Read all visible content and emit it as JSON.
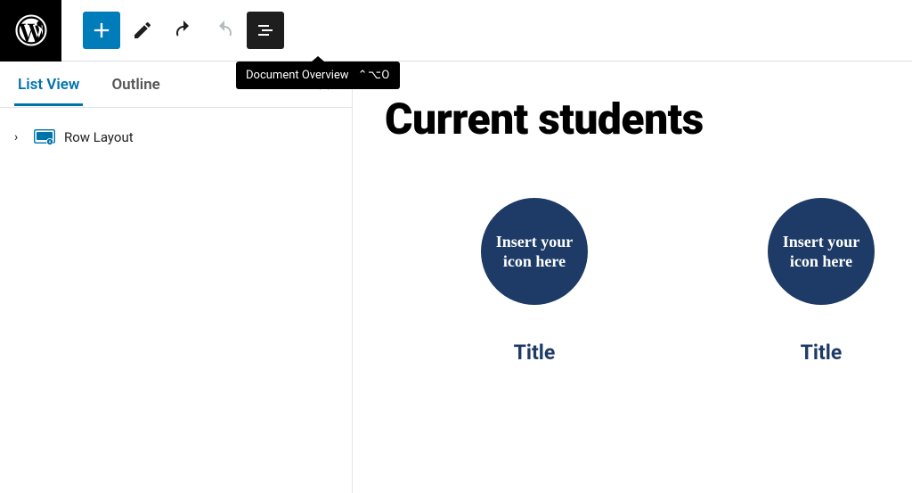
{
  "colors": {
    "wp_blue": "#007cba",
    "wp_dark": "#1e1e1e",
    "navy": "#1d3b66",
    "tab_active": "#0073aa"
  },
  "toolbar": {
    "tooltip_text": "Document Overview",
    "tooltip_shortcut": "⌃⌥O"
  },
  "sidebar": {
    "tabs": {
      "list_view": "List View",
      "outline": "Outline"
    },
    "tree": {
      "row_layout": "Row Layout"
    }
  },
  "page": {
    "title": "Current students",
    "icon_placeholder": "Insert your icon here",
    "items": [
      {
        "title": "Title"
      },
      {
        "title": "Title"
      }
    ]
  }
}
